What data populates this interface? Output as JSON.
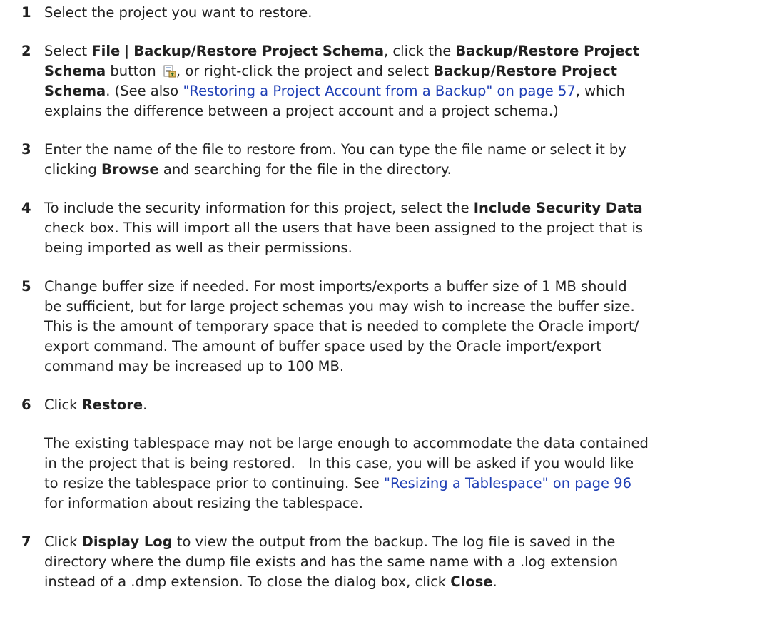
{
  "steps": [
    {
      "number": "1",
      "text": "Select the project you want to restore."
    },
    {
      "number": "2",
      "part1": "Select ",
      "bold_file": "File",
      "part2": " | ",
      "bold_menu": "Backup/Restore Project Schema",
      "part3": ", click the ",
      "bold_button_line1": "Backup/Restore Project",
      "bold_button_line2": "Schema",
      "part4": " button ",
      "part5": ", or right-click the project and select ",
      "bold_context": "Backup/Restore Project",
      "bold_context2": "Schema",
      "part6": ". (See also ",
      "link_text": "\"Restoring a Project Account from a Backup\" on page 57",
      "part7": ", which",
      "part8": "explains the difference between a project account and a project schema.)",
      "icon": "backup-restore-schema-icon"
    },
    {
      "number": "3",
      "part1": "Enter the name of the file to restore from. You can type the file name or select it by",
      "part2": "clicking ",
      "bold": "Browse",
      "part3": " and searching for the file in the directory."
    },
    {
      "number": "4",
      "part1": "To include the security information for this project, select the ",
      "bold": "Include Security Data",
      "part2": "check box. This will import all the users that have been assigned to the project that is",
      "part3": "being imported as well as their permissions."
    },
    {
      "number": "5",
      "line1": "Change buffer size if needed. For most imports/exports a buffer size of 1 MB should",
      "line2": "be sufficient, but for large project schemas you may wish to increase the buffer size.",
      "line3": "This is the amount of temporary space that is needed to complete the Oracle import/",
      "line4": "export command. The amount of buffer space used by the Oracle import/export",
      "line5": "command may be increased up to 100 MB."
    },
    {
      "number": "6",
      "part1": "Click ",
      "bold": "Restore",
      "part2": ".",
      "note_line1": "The existing tablespace may not be large enough to accommodate the data contained",
      "note_line2": "in the project that is being restored.   In this case, you will be asked if you would like",
      "note_line3a": "to resize the tablespace prior to continuing. See ",
      "note_link": "\"Resizing a Tablespace\" on page 96",
      "note_line4": "for information about resizing the tablespace."
    },
    {
      "number": "7",
      "part1": "Click ",
      "bold1": "Display Log",
      "part2": " to view the output from the backup. The log file is saved in the",
      "line2": "directory where the dump file exists and has the same name with a .log extension",
      "part3": "instead of a .dmp extension. To close the dialog box, click ",
      "bold2": "Close",
      "part4": "."
    }
  ],
  "colors": {
    "text": "#222222",
    "link": "#1f3fb5"
  }
}
